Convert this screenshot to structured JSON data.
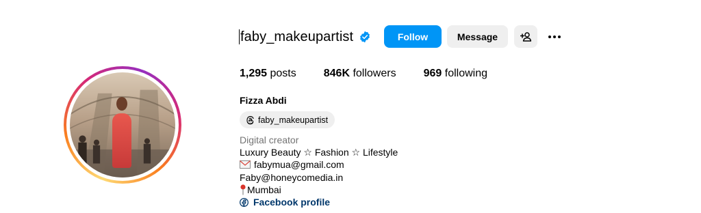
{
  "profile": {
    "username": "faby_makeupartist",
    "follow_label": "Follow",
    "message_label": "Message",
    "stats": {
      "posts_count": "1,295",
      "posts_label": "posts",
      "followers_count": "846K",
      "followers_label": "followers",
      "following_count": "969",
      "following_label": "following"
    },
    "full_name": "Fizza Abdi",
    "threads_handle": "faby_makeupartist",
    "bio": {
      "category": "Digital creator",
      "tagline": "Luxury Beauty ☆ Fashion ☆ Lifestyle",
      "email": "fabymua@gmail.com",
      "web": "Faby@honeycomedia.in",
      "location": "Mumbai"
    },
    "facebook_link": "Facebook profile"
  },
  "colors": {
    "primary_button": "#0095f6",
    "secondary_button": "#efefef",
    "verified_badge": "#0095f6",
    "link": "#00376b",
    "muted_text": "#737373"
  },
  "icons": {
    "verified": "verified-badge-icon",
    "add_user": "add-user-icon",
    "more": "more-options-icon",
    "threads": "threads-icon",
    "email": "envelope-icon",
    "location": "pin-icon",
    "facebook": "facebook-icon"
  }
}
